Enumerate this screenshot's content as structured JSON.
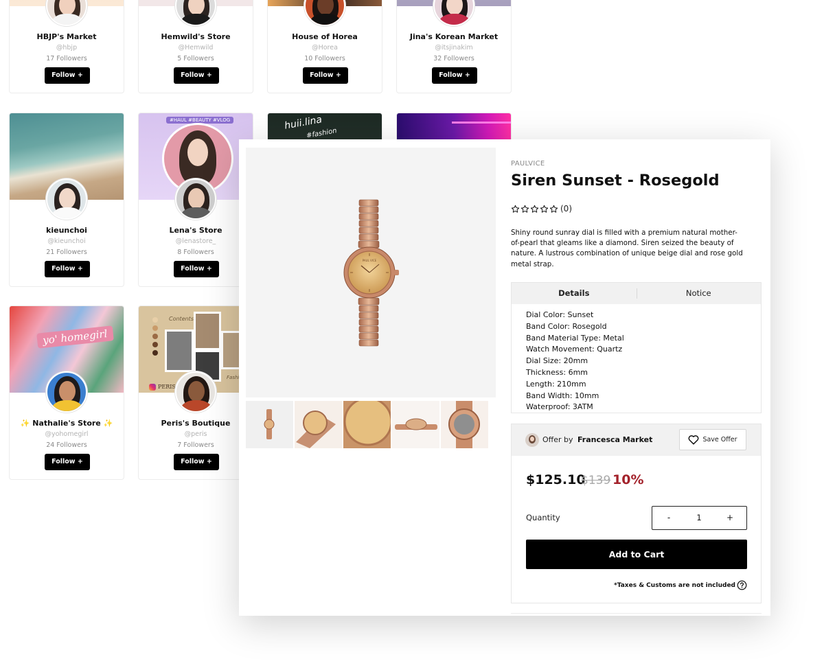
{
  "stores": [
    {
      "name": "HBJP's Market",
      "handle": "@hbjp",
      "followers": "17 Followers",
      "follow_label": "Follow +"
    },
    {
      "name": "Hemwild's Store",
      "handle": "@Hemwild",
      "followers": "5 Followers",
      "follow_label": "Follow +"
    },
    {
      "name": "House of Horea",
      "handle": "@Horea",
      "followers": "10 Followers",
      "follow_label": "Follow +"
    },
    {
      "name": "Jina's Korean Market",
      "handle": "@itsjinakim",
      "followers": "32 Followers",
      "follow_label": "Follow +"
    },
    {
      "name": "kieunchoi",
      "handle": "@kieunchoi",
      "followers": "21 Followers",
      "follow_label": "Follow +"
    },
    {
      "name": "Lena's Store",
      "handle": "@lenastore_",
      "followers": "8 Followers",
      "follow_label": "Follow +"
    },
    {
      "name": "✨ Nathalie's Store ✨",
      "handle": "@yohomegirl",
      "followers": "24 Followers",
      "follow_label": "Follow +"
    },
    {
      "name": "Peris's Boutique",
      "handle": "@peris",
      "followers": "7 Followers",
      "follow_label": "Follow +"
    }
  ],
  "cover_texts": {
    "banner_lena": "#HAUL #BEAUTY #VLOG",
    "banner_fashion": "huii.lina",
    "banner_fashion_tag": "#fashion",
    "banner_nathalie": "yo' homegirl",
    "banner_peris": "PERIS",
    "peris_script_1": "Contents",
    "peris_script_2": "Fashion"
  },
  "product": {
    "brand": "PAULVICE",
    "title": "Siren Sunset - Rosegold",
    "rating_count": "(0)",
    "rating_stars": 0,
    "description": "Shiny round sunray dial is filled with a premium natural mother-of-pearl that gleams like a diamond. Siren seized the beauty of nature. A lustrous combination of unique beige dial and rose gold metal strap.",
    "tabs": [
      {
        "label": "Details",
        "active": true
      },
      {
        "label": "Notice",
        "active": false
      }
    ],
    "details": [
      "Dial Color: Sunset",
      "Band Color: Rosegold",
      "Band Material Type: Metal",
      "Watch Movement: Quartz",
      "Dial Size: 20mm",
      "Thickness: 6mm",
      "Length: 210mm",
      "Band Width: 10mm",
      "Waterproof: 3ATM"
    ],
    "dial_brand_text": "PAUL VICE"
  },
  "offer": {
    "offer_by_label": "Offer by",
    "seller": "Francesca Market",
    "save_label": "Save Offer",
    "price": "$125.10",
    "original_price": "$139",
    "discount": "10%",
    "quantity_label": "Quantity",
    "quantity": "1",
    "minus": "-",
    "plus": "+",
    "add_to_cart": "Add to Cart",
    "tax_note": "*Taxes & Customs are not included"
  },
  "colors": {
    "accent_black": "#000000",
    "discount_red": "#a3222b",
    "rose_gold": "#c99073"
  },
  "icons": [
    "star-outline-icon",
    "heart-outline-icon",
    "question-circle-icon",
    "watch-image"
  ]
}
